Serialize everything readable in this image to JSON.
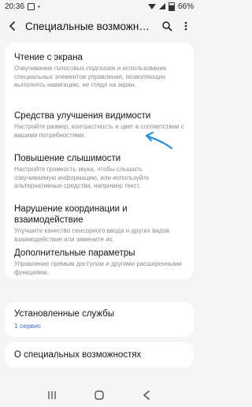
{
  "status_bar": {
    "time": "20:36",
    "battery": "66%"
  },
  "app_bar": {
    "title": "Специальные возможности"
  },
  "items": [
    {
      "title": "Чтение с экрана",
      "desc": "Озвучивание голосовых подсказок и использование специальных элементов управления, позволяющих выполнять навигацию, не глядя на экран."
    },
    {
      "title": "Средства улучшения видимости",
      "desc": "Настройте размер, контрастность и цвет в соответствии с вашими потребностями."
    },
    {
      "title": "Повышение слышимости",
      "desc": "Настройте громкость звука, чтобы слышать озвучиваемую информацию, или используйте альтернативные средства, например текст."
    },
    {
      "title": "Нарушение координации и взаимодействие",
      "desc": "Улучшите качество сенсорного ввода и других видов взаимодействия или замените их."
    },
    {
      "title": "Дополнительные параметры",
      "desc": "Управление прямым доступом и другими расширенными функциями."
    }
  ],
  "installed_services": {
    "title": "Установленные службы",
    "subtitle": "1 сервис"
  },
  "about": {
    "title": "О специальных возможностях"
  },
  "colors": {
    "accent_link": "#3f6fc2",
    "arrow": "#2a8fd6",
    "background": "#f5f5f5"
  }
}
